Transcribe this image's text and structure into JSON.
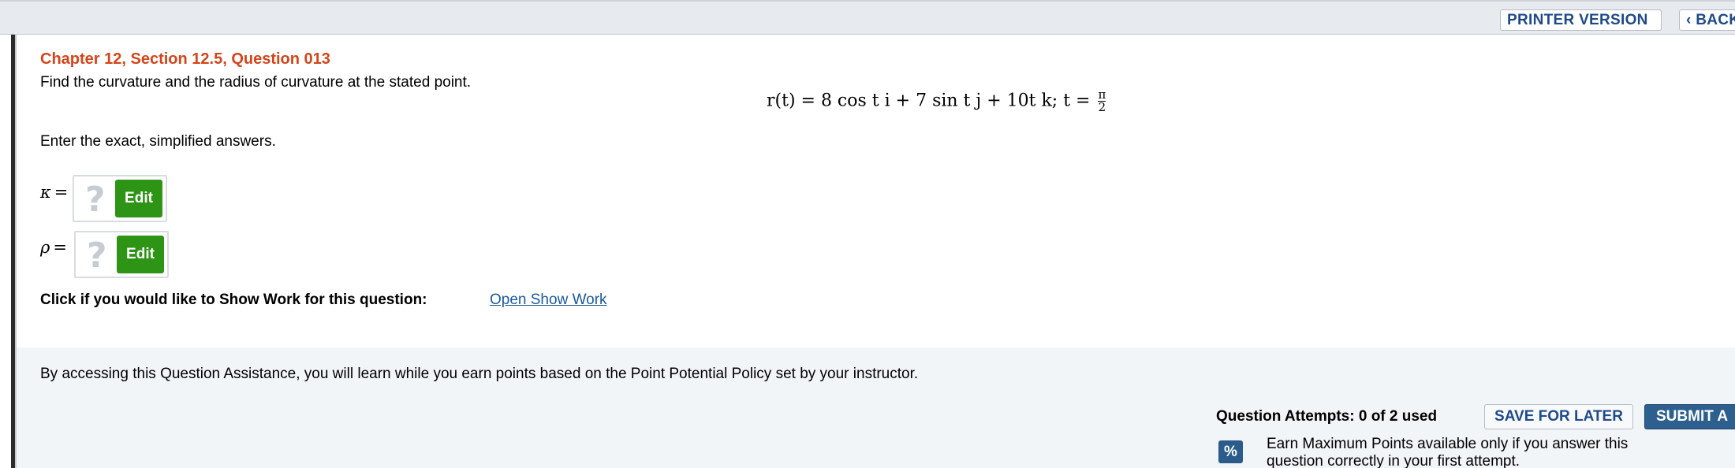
{
  "toolbar": {
    "printer_label": "PRINTER VERSION",
    "back_label": "‹ BACK"
  },
  "question": {
    "title": "Chapter 12, Section 12.5, Question 013",
    "prompt": "Find the curvature and the radius of curvature at the stated point.",
    "formula_main": "r(t) = 8  cos  t i + 7  sin  t j + 10t k;   t =",
    "formula_num": "π",
    "formula_den": "2",
    "instructions": "Enter the exact, simplified answers."
  },
  "answers": [
    {
      "symbol": "κ",
      "eq": "=",
      "placeholder": "?",
      "edit_label": "Edit"
    },
    {
      "symbol": "ρ",
      "eq": "=",
      "placeholder": "?",
      "edit_label": "Edit"
    }
  ],
  "show_work": {
    "label": "Click if you would like to Show Work for this question:",
    "link": "Open Show Work"
  },
  "assistance": {
    "text": "By accessing this Question Assistance, you will learn while you earn points based on the Point Potential Policy set by your instructor."
  },
  "footer": {
    "attempts": "Question Attempts: 0 of 2 used",
    "save_label": "SAVE FOR LATER",
    "submit_label": "SUBMIT A",
    "percent_icon": "%",
    "earn_text": "Earn Maximum Points available only if you answer this question correctly in your first attempt."
  },
  "colors": {
    "title": "#d4451a",
    "edit_button": "#2e9416",
    "link": "#1a5a9c",
    "submit_button": "#2d5f8f"
  }
}
